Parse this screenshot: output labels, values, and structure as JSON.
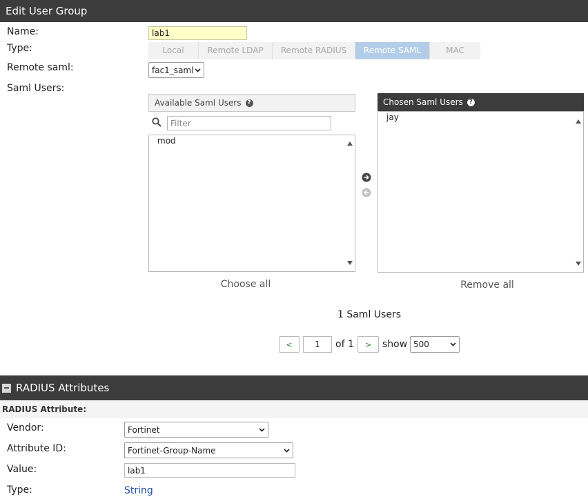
{
  "window": {
    "title": "Edit User Group"
  },
  "form": {
    "name_label": "Name:",
    "name_value": "lab1",
    "type_label": "Type:",
    "type_tabs": [
      {
        "label": "Local"
      },
      {
        "label": "Remote LDAP"
      },
      {
        "label": "Remote RADIUS"
      },
      {
        "label": "Remote SAML"
      },
      {
        "label": "MAC"
      }
    ],
    "active_type": "Remote SAML",
    "remote_saml_label": "Remote saml:",
    "remote_saml_value": "fac1_saml",
    "saml_users_label": "Saml Users:"
  },
  "available": {
    "title": "Available Saml Users",
    "filter_placeholder": "Filter",
    "items": [
      "mod"
    ],
    "choose_all": "Choose all"
  },
  "chosen": {
    "title": "Chosen Saml Users",
    "items": [
      "jay"
    ],
    "remove_all": "Remove all"
  },
  "pagination": {
    "count_text": "1 Saml Users",
    "prev": "<",
    "page": "1",
    "of_text": "of 1",
    "next": ">",
    "show_text": "show",
    "page_size": "500"
  },
  "radius": {
    "section_title": "RADIUS Attributes",
    "subheader": "RADIUS Attribute:",
    "vendor_label": "Vendor:",
    "vendor_value": "Fortinet",
    "attribute_id_label": "Attribute ID:",
    "attribute_id_value": "Fortinet-Group-Name",
    "value_label": "Value:",
    "value_value": "lab1",
    "type_label": "Type:",
    "type_value": "String"
  },
  "colors": {
    "header_bg": "#3c3c3c",
    "active_tab": "#b3cde8",
    "name_field_bg": "#ffffc8",
    "link_blue": "#1f4ea8"
  }
}
